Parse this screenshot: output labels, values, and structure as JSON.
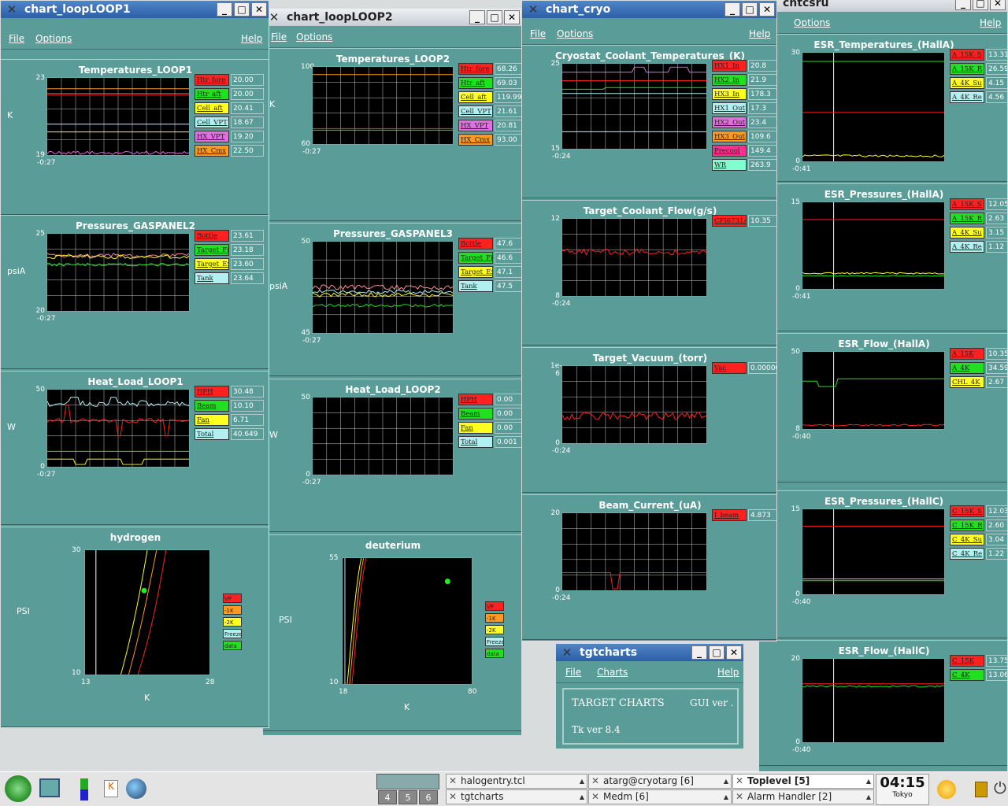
{
  "windows": {
    "loop1": {
      "title": "chart_loopLOOP1"
    },
    "loop2": {
      "title": "chart_loopLOOP2"
    },
    "cryo": {
      "title": "chart_cryo"
    },
    "esr": {
      "title": "chtcsru"
    },
    "tgt": {
      "title": "tgtcharts"
    }
  },
  "menus": {
    "file": "File",
    "options": "Options",
    "help": "Help",
    "charts": "Charts"
  },
  "tgtcharts": {
    "heading": "TARGET CHARTS",
    "gui": "GUI ver .",
    "tk": "Tk ver 8.4"
  },
  "panels": [
    {
      "id": "l1t",
      "title": "Temperatures_LOOP1",
      "ylabel": "K",
      "ymax": "23",
      "ymin": "19",
      "xmin": "-0:27",
      "legend": [
        {
          "n": "Htr_fore",
          "v": "20.00",
          "c": "#ff2020"
        },
        {
          "n": "Htr_aft",
          "v": "20.00",
          "c": "#20e020"
        },
        {
          "n": "Cell_aft",
          "v": "20.41",
          "c": "#ffff20"
        },
        {
          "n": "Cell_VPT",
          "v": "18.67",
          "c": "#b0f0f0"
        },
        {
          "n": "HX_VPT",
          "v": "19.20",
          "c": "#e070e0"
        },
        {
          "n": "HX_Cmx",
          "v": "22.50",
          "c": "#ff9a20"
        }
      ]
    },
    {
      "id": "l1p",
      "title": "Pressures_GASPANEL2",
      "ylabel": "psiA",
      "ymax": "25",
      "ymin": "20",
      "xmin": "-0:27",
      "legend": [
        {
          "n": "Bottle",
          "v": "23.61",
          "c": "#ff2020"
        },
        {
          "n": "Target_Fi",
          "v": "23.18",
          "c": "#20e020"
        },
        {
          "n": "Target_Ex",
          "v": "23.60",
          "c": "#ffff20"
        },
        {
          "n": "Tank",
          "v": "23.64",
          "c": "#b0f0f0"
        }
      ]
    },
    {
      "id": "l1h",
      "title": "Heat_Load_LOOP1",
      "ylabel": "W",
      "ymax": "50",
      "ymin": "0",
      "xmin": "-0:27",
      "legend": [
        {
          "n": "HPH",
          "v": "30.48",
          "c": "#ff2020"
        },
        {
          "n": "Beam",
          "v": "10.10",
          "c": "#20e020"
        },
        {
          "n": "Fan",
          "v": "6.71",
          "c": "#ffff20"
        },
        {
          "n": "Total",
          "v": "40.649",
          "c": "#b0f0f0"
        }
      ]
    },
    {
      "id": "l2t",
      "title": "Temperatures_LOOP2",
      "ylabel": "K",
      "ymax": "100",
      "ymin": "60",
      "xmin": "-0:27",
      "legend": [
        {
          "n": "Htr_fore",
          "v": "68.26",
          "c": "#ff2020"
        },
        {
          "n": "Htr_aft",
          "v": "69.03",
          "c": "#20e020"
        },
        {
          "n": "Cell_aft",
          "v": "119.99",
          "c": "#ffff20"
        },
        {
          "n": "Cell_VPT",
          "v": "21.61",
          "c": "#b0f0f0"
        },
        {
          "n": "HX_VPT",
          "v": "20.81",
          "c": "#e070e0"
        },
        {
          "n": "HX_Cmx",
          "v": "93.00",
          "c": "#ff9a20"
        }
      ]
    },
    {
      "id": "l2p",
      "title": "Pressures_GASPANEL3",
      "ylabel": "psiA",
      "ymax": "50",
      "ymin": "45",
      "xmin": "-0:27",
      "legend": [
        {
          "n": "Bottle",
          "v": "47.6",
          "c": "#ff2020"
        },
        {
          "n": "Target_Fi",
          "v": "46.6",
          "c": "#20e020"
        },
        {
          "n": "Target_Ex",
          "v": "47.1",
          "c": "#ffff20"
        },
        {
          "n": "Tank",
          "v": "47.5",
          "c": "#b0f0f0"
        }
      ]
    },
    {
      "id": "l2h",
      "title": "Heat_Load_LOOP2",
      "ylabel": "W",
      "ymax": "50",
      "ymin": "0",
      "xmin": "-0:27",
      "legend": [
        {
          "n": "HPH",
          "v": "0.00",
          "c": "#ff2020"
        },
        {
          "n": "Beam",
          "v": "0.00",
          "c": "#20e020"
        },
        {
          "n": "Fan",
          "v": "0.00",
          "c": "#ffff20"
        },
        {
          "n": "Total",
          "v": "0.001",
          "c": "#b0f0f0"
        }
      ]
    },
    {
      "id": "ct",
      "title": "Cryostat_Coolant_Temperatures_(K)",
      "ylabel": "",
      "ymax": "25",
      "ymin": "15",
      "xmin": "-0:24",
      "legend": [
        {
          "n": "HX1_In",
          "v": "20.8",
          "c": "#ff2020"
        },
        {
          "n": "HX2_In",
          "v": "21.9",
          "c": "#20e020"
        },
        {
          "n": "HX3_In",
          "v": "178.3",
          "c": "#ffff20"
        },
        {
          "n": "HX1_Out",
          "v": "17.3",
          "c": "#b0f0f0"
        },
        {
          "n": "HX2_Out",
          "v": "23.4",
          "c": "#e070e0"
        },
        {
          "n": "HX3_Out",
          "v": "109.6",
          "c": "#ff9a20"
        },
        {
          "n": "Precool",
          "v": "149.4",
          "c": "#ff3090"
        },
        {
          "n": "WR",
          "v": "263.9",
          "c": "#80ffd0"
        }
      ]
    },
    {
      "id": "cf",
      "title": "Target_Coolant_Flow(g/s)",
      "ylabel": "",
      "ymax": "12",
      "ymin": "8",
      "xmin": "-0:24",
      "legend": [
        {
          "n": "CFI6731A",
          "v": "10.35",
          "c": "#ff2020"
        }
      ]
    },
    {
      "id": "cv",
      "title": "Target_Vacuum_(torr)",
      "ylabel": "",
      "ymax": "1e-6",
      "ymin": "0",
      "xmin": "-0:24",
      "legend": [
        {
          "n": "Vac",
          "v": "0.00000",
          "c": "#ff2020"
        }
      ]
    },
    {
      "id": "cb",
      "title": "Beam_Current_(uA)",
      "ylabel": "",
      "ymax": "20",
      "ymin": "0",
      "xmin": "-0:24",
      "legend": [
        {
          "n": "I_beam",
          "v": "4.873",
          "c": "#ff2020"
        }
      ]
    },
    {
      "id": "e1",
      "title": "ESR_Temperatures_(HallA)",
      "ylabel": "",
      "ymax": "30",
      "ymin": "0",
      "xmin": "-0:41",
      "legend": [
        {
          "n": "A_15K_S",
          "v": "13.31",
          "c": "#ff2020"
        },
        {
          "n": "A_15K_R",
          "v": "26.59",
          "c": "#20e020"
        },
        {
          "n": "A_4K_Su",
          "v": "4.15",
          "c": "#ffff20"
        },
        {
          "n": "A_4K_Re",
          "v": "4.56",
          "c": "#b0f0f0"
        }
      ]
    },
    {
      "id": "e2",
      "title": "ESR_Pressures_(HallA)",
      "ylabel": "",
      "ymax": "15",
      "ymin": "0",
      "xmin": "-0:41",
      "legend": [
        {
          "n": "A_15K_S",
          "v": "12.05",
          "c": "#ff2020"
        },
        {
          "n": "A_15K_R",
          "v": "2.63",
          "c": "#20e020"
        },
        {
          "n": "A_4K_Su",
          "v": "3.15",
          "c": "#ffff20"
        },
        {
          "n": "A_4K_Re",
          "v": "1.12",
          "c": "#b0f0f0"
        }
      ]
    },
    {
      "id": "e3",
      "title": "ESR_Flow_(HallA)",
      "ylabel": "",
      "ymax": "50",
      "ymin": "8",
      "xmin": "-0:40",
      "legend": [
        {
          "n": "A_15K",
          "v": "10.35",
          "c": "#ff2020"
        },
        {
          "n": "A_4K",
          "v": "34.59",
          "c": "#20e020"
        },
        {
          "n": "CHL_4K",
          "v": "2.67",
          "c": "#ffff20"
        }
      ]
    },
    {
      "id": "e4",
      "title": "ESR_Pressures_(HallC)",
      "ylabel": "",
      "ymax": "15",
      "ymin": "0",
      "xmin": "-0:40",
      "legend": [
        {
          "n": "C_15K_S",
          "v": "12.03",
          "c": "#ff2020"
        },
        {
          "n": "C_15K_R",
          "v": "2.60",
          "c": "#20e020"
        },
        {
          "n": "C_4K_Su",
          "v": "3.04",
          "c": "#ffff20"
        },
        {
          "n": "C_4K_Re",
          "v": "1.22",
          "c": "#b0f0f0"
        }
      ]
    },
    {
      "id": "e5",
      "title": "ESR_Flow_(HallC)",
      "ylabel": "",
      "ymax": "20",
      "ymin": "0",
      "xmin": "-0:40",
      "legend": [
        {
          "n": "C_15K",
          "v": "13.75",
          "c": "#ff2020"
        },
        {
          "n": "C_4K",
          "v": "13.06",
          "c": "#20e020"
        }
      ]
    }
  ],
  "phase": [
    {
      "id": "h",
      "title": "hydrogen",
      "ylabel": "PSI",
      "xlabel": "K",
      "xmin": "13",
      "xmax": "28",
      "ymin": "10",
      "ymax": "30",
      "legend": [
        {
          "n": "VP",
          "c": "#ff2020"
        },
        {
          "n": "-1K",
          "c": "#ff9a20"
        },
        {
          "n": "-2K",
          "c": "#ffff20"
        },
        {
          "n": "Freeze",
          "c": "#b0f0f0"
        },
        {
          "n": "data",
          "c": "#20e020"
        }
      ]
    },
    {
      "id": "d",
      "title": "deuterium",
      "ylabel": "PSI",
      "xlabel": "K",
      "xmin": "18",
      "xmax": "80",
      "ymin": "10",
      "ymax": "55",
      "legend": [
        {
          "n": "VP",
          "c": "#ff2020"
        },
        {
          "n": "-1K",
          "c": "#ff9a20"
        },
        {
          "n": "-2K",
          "c": "#ffff20"
        },
        {
          "n": "Freeze",
          "c": "#b0f0f0"
        },
        {
          "n": "data",
          "c": "#20e020"
        }
      ]
    }
  ],
  "taskbar": {
    "workspaces": [
      "4",
      "5",
      "6"
    ],
    "tasks": [
      "halogentry.tcl",
      "atarg@cryotarg [6]",
      "Toplevel [5]",
      "tgtcharts",
      "Medm [6]",
      "Alarm Handler [2]"
    ],
    "clock": "04:15",
    "city": "Tokyo"
  },
  "icons": {
    "menu": "gecko-icon",
    "files": "file-manager-icon",
    "bars": "system-monitor-icon",
    "konq": "konqueror-icon",
    "globe": "globe-icon",
    "sun": "sun-icon",
    "lock": "lock-icon"
  }
}
